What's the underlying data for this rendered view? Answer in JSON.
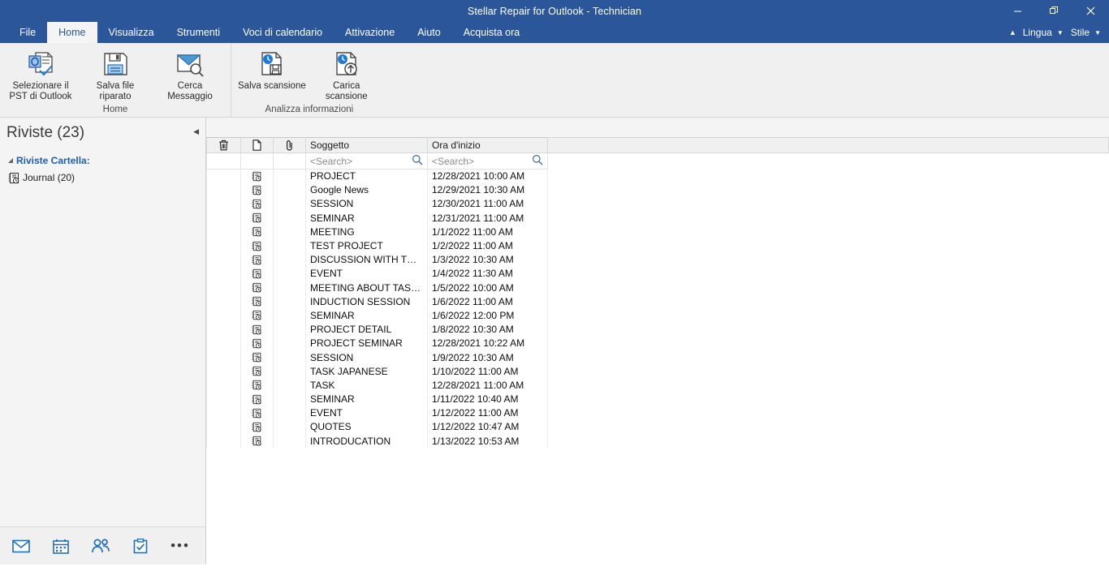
{
  "window": {
    "title": "Stellar Repair for Outlook - Technician",
    "controls": [
      {
        "name": "minimize-button",
        "glyph": "minimize"
      },
      {
        "name": "restore-button",
        "glyph": "restore"
      },
      {
        "name": "close-button",
        "glyph": "close"
      }
    ]
  },
  "tabs": [
    {
      "label": "File",
      "active": false
    },
    {
      "label": "Home",
      "active": true
    },
    {
      "label": "Visualizza",
      "active": false
    },
    {
      "label": "Strumenti",
      "active": false
    },
    {
      "label": "Voci di calendario",
      "active": false
    },
    {
      "label": "Attivazione",
      "active": false
    },
    {
      "label": "Aiuto",
      "active": false
    },
    {
      "label": "Acquista ora",
      "active": false
    }
  ],
  "tab_right": {
    "collapse_icon": "chevron-up-icon",
    "language_label": "Lingua",
    "style_label": "Stile"
  },
  "ribbon": {
    "groups": [
      {
        "name": "Home",
        "items": [
          {
            "label": "Selezionare il PST di Outlook",
            "icon": "select-pst-icon"
          },
          {
            "label": "Salva file riparato",
            "icon": "save-file-icon"
          },
          {
            "label": "Cerca Messaggio",
            "icon": "find-message-icon"
          }
        ]
      },
      {
        "name": "Analizza informazioni",
        "items": [
          {
            "label": "Salva scansione",
            "icon": "save-scan-icon"
          },
          {
            "label": "Carica scansione",
            "icon": "load-scan-icon"
          }
        ]
      }
    ]
  },
  "sidebar": {
    "title": "Riviste (23)",
    "root_label": "Riviste Cartella:",
    "child_label": "Journal (20)",
    "nav_icons": [
      {
        "name": "mail-icon"
      },
      {
        "name": "calendar-icon"
      },
      {
        "name": "contacts-icon"
      },
      {
        "name": "tasks-icon"
      },
      {
        "name": "more-options-icon"
      }
    ]
  },
  "grid": {
    "columns": [
      {
        "key": "delete",
        "label": "",
        "icon": "trash-icon"
      },
      {
        "key": "document",
        "label": "",
        "icon": "document-icon"
      },
      {
        "key": "attachment",
        "label": "",
        "icon": "paperclip-icon"
      },
      {
        "key": "subject",
        "label": "Soggetto",
        "icon": ""
      },
      {
        "key": "start",
        "label": "Ora d'inizio",
        "icon": ""
      }
    ],
    "search_placeholder": "<Search>",
    "search_icon": "search-icon",
    "rows": [
      {
        "subject": "PROJECT",
        "start": "12/28/2021 10:00 AM"
      },
      {
        "subject": "Google News",
        "start": "12/29/2021 10:30 AM"
      },
      {
        "subject": "SESSION",
        "start": "12/30/2021 11:00 AM"
      },
      {
        "subject": "SEMINAR",
        "start": "12/31/2021 11:00 AM"
      },
      {
        "subject": "MEETING",
        "start": "1/1/2022 11:00 AM"
      },
      {
        "subject": "TEST PROJECT",
        "start": "1/2/2022 11:00 AM"
      },
      {
        "subject": "DISCUSSION WITH TEAM",
        "start": "1/3/2022 10:30 AM"
      },
      {
        "subject": "EVENT",
        "start": "1/4/2022 11:30 AM"
      },
      {
        "subject": "MEETING ABOUT TASK P...",
        "start": "1/5/2022 10:00 AM"
      },
      {
        "subject": "INDUCTION SESSION",
        "start": "1/6/2022 11:00 AM"
      },
      {
        "subject": "SEMINAR",
        "start": "1/6/2022 12:00 PM"
      },
      {
        "subject": "PROJECT DETAIL",
        "start": "1/8/2022 10:30 AM"
      },
      {
        "subject": "PROJECT SEMINAR",
        "start": "12/28/2021 10:22 AM"
      },
      {
        "subject": "SESSION",
        "start": "1/9/2022 10:30 AM"
      },
      {
        "subject": "TASK JAPANESE",
        "start": "1/10/2022 11:00 AM"
      },
      {
        "subject": "TASK",
        "start": "12/28/2021 11:00 AM"
      },
      {
        "subject": "SEMINAR",
        "start": "1/11/2022 10:40 AM"
      },
      {
        "subject": "EVENT",
        "start": "1/12/2022 11:00 AM"
      },
      {
        "subject": "QUOTES",
        "start": "1/12/2022 10:47 AM"
      },
      {
        "subject": "INTRODUCATION",
        "start": "1/13/2022 10:53 AM"
      }
    ]
  },
  "colors": {
    "brand_blue": "#2b579a",
    "accent_blue": "#1f5fae",
    "ribbon_bg": "#f0f0f0",
    "sidebar_bg": "#f4f4f4"
  }
}
